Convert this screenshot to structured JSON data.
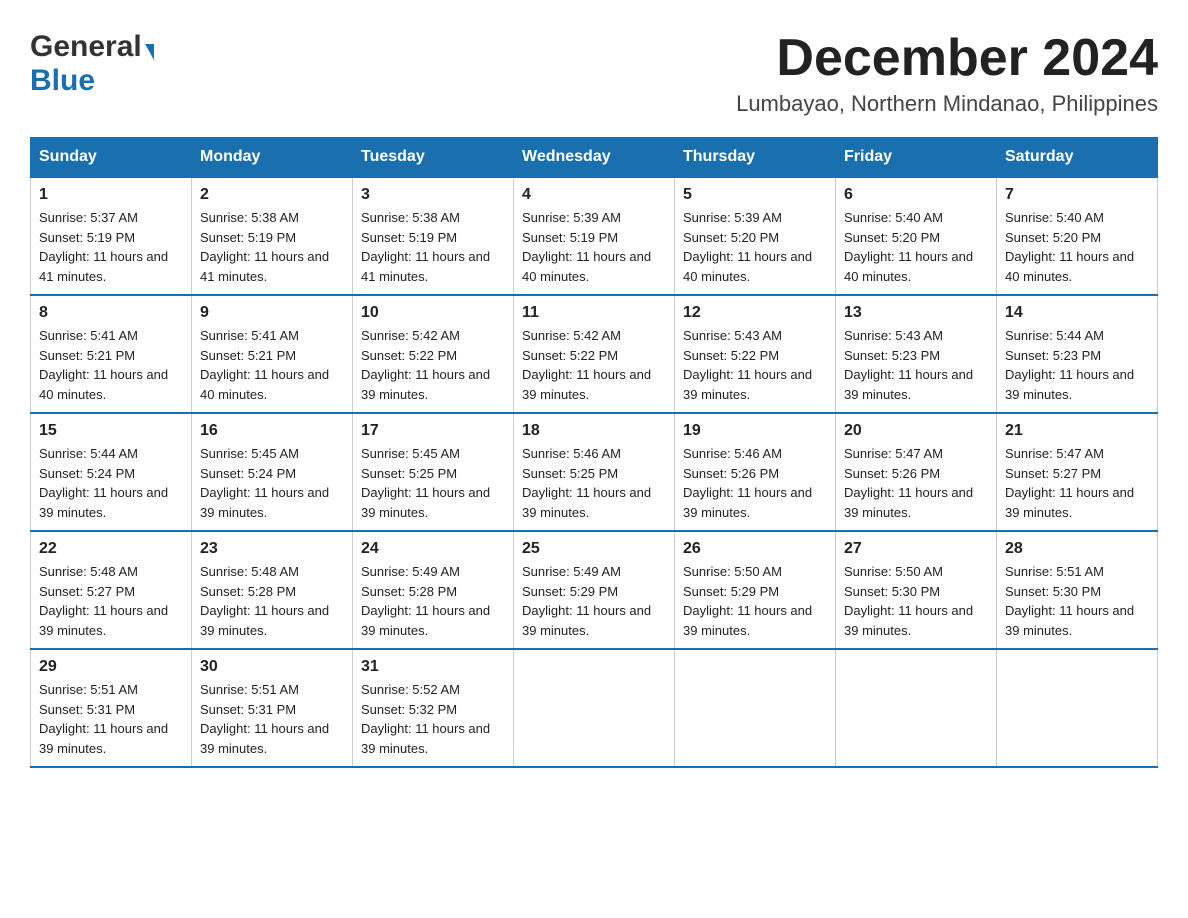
{
  "header": {
    "logo_general": "General",
    "logo_blue": "Blue",
    "month_title": "December 2024",
    "location": "Lumbayao, Northern Mindanao, Philippines"
  },
  "days_of_week": [
    "Sunday",
    "Monday",
    "Tuesday",
    "Wednesday",
    "Thursday",
    "Friday",
    "Saturday"
  ],
  "weeks": [
    [
      {
        "day": "1",
        "sunrise": "5:37 AM",
        "sunset": "5:19 PM",
        "daylight": "11 hours and 41 minutes."
      },
      {
        "day": "2",
        "sunrise": "5:38 AM",
        "sunset": "5:19 PM",
        "daylight": "11 hours and 41 minutes."
      },
      {
        "day": "3",
        "sunrise": "5:38 AM",
        "sunset": "5:19 PM",
        "daylight": "11 hours and 41 minutes."
      },
      {
        "day": "4",
        "sunrise": "5:39 AM",
        "sunset": "5:19 PM",
        "daylight": "11 hours and 40 minutes."
      },
      {
        "day": "5",
        "sunrise": "5:39 AM",
        "sunset": "5:20 PM",
        "daylight": "11 hours and 40 minutes."
      },
      {
        "day": "6",
        "sunrise": "5:40 AM",
        "sunset": "5:20 PM",
        "daylight": "11 hours and 40 minutes."
      },
      {
        "day": "7",
        "sunrise": "5:40 AM",
        "sunset": "5:20 PM",
        "daylight": "11 hours and 40 minutes."
      }
    ],
    [
      {
        "day": "8",
        "sunrise": "5:41 AM",
        "sunset": "5:21 PM",
        "daylight": "11 hours and 40 minutes."
      },
      {
        "day": "9",
        "sunrise": "5:41 AM",
        "sunset": "5:21 PM",
        "daylight": "11 hours and 40 minutes."
      },
      {
        "day": "10",
        "sunrise": "5:42 AM",
        "sunset": "5:22 PM",
        "daylight": "11 hours and 39 minutes."
      },
      {
        "day": "11",
        "sunrise": "5:42 AM",
        "sunset": "5:22 PM",
        "daylight": "11 hours and 39 minutes."
      },
      {
        "day": "12",
        "sunrise": "5:43 AM",
        "sunset": "5:22 PM",
        "daylight": "11 hours and 39 minutes."
      },
      {
        "day": "13",
        "sunrise": "5:43 AM",
        "sunset": "5:23 PM",
        "daylight": "11 hours and 39 minutes."
      },
      {
        "day": "14",
        "sunrise": "5:44 AM",
        "sunset": "5:23 PM",
        "daylight": "11 hours and 39 minutes."
      }
    ],
    [
      {
        "day": "15",
        "sunrise": "5:44 AM",
        "sunset": "5:24 PM",
        "daylight": "11 hours and 39 minutes."
      },
      {
        "day": "16",
        "sunrise": "5:45 AM",
        "sunset": "5:24 PM",
        "daylight": "11 hours and 39 minutes."
      },
      {
        "day": "17",
        "sunrise": "5:45 AM",
        "sunset": "5:25 PM",
        "daylight": "11 hours and 39 minutes."
      },
      {
        "day": "18",
        "sunrise": "5:46 AM",
        "sunset": "5:25 PM",
        "daylight": "11 hours and 39 minutes."
      },
      {
        "day": "19",
        "sunrise": "5:46 AM",
        "sunset": "5:26 PM",
        "daylight": "11 hours and 39 minutes."
      },
      {
        "day": "20",
        "sunrise": "5:47 AM",
        "sunset": "5:26 PM",
        "daylight": "11 hours and 39 minutes."
      },
      {
        "day": "21",
        "sunrise": "5:47 AM",
        "sunset": "5:27 PM",
        "daylight": "11 hours and 39 minutes."
      }
    ],
    [
      {
        "day": "22",
        "sunrise": "5:48 AM",
        "sunset": "5:27 PM",
        "daylight": "11 hours and 39 minutes."
      },
      {
        "day": "23",
        "sunrise": "5:48 AM",
        "sunset": "5:28 PM",
        "daylight": "11 hours and 39 minutes."
      },
      {
        "day": "24",
        "sunrise": "5:49 AM",
        "sunset": "5:28 PM",
        "daylight": "11 hours and 39 minutes."
      },
      {
        "day": "25",
        "sunrise": "5:49 AM",
        "sunset": "5:29 PM",
        "daylight": "11 hours and 39 minutes."
      },
      {
        "day": "26",
        "sunrise": "5:50 AM",
        "sunset": "5:29 PM",
        "daylight": "11 hours and 39 minutes."
      },
      {
        "day": "27",
        "sunrise": "5:50 AM",
        "sunset": "5:30 PM",
        "daylight": "11 hours and 39 minutes."
      },
      {
        "day": "28",
        "sunrise": "5:51 AM",
        "sunset": "5:30 PM",
        "daylight": "11 hours and 39 minutes."
      }
    ],
    [
      {
        "day": "29",
        "sunrise": "5:51 AM",
        "sunset": "5:31 PM",
        "daylight": "11 hours and 39 minutes."
      },
      {
        "day": "30",
        "sunrise": "5:51 AM",
        "sunset": "5:31 PM",
        "daylight": "11 hours and 39 minutes."
      },
      {
        "day": "31",
        "sunrise": "5:52 AM",
        "sunset": "5:32 PM",
        "daylight": "11 hours and 39 minutes."
      },
      null,
      null,
      null,
      null
    ]
  ],
  "labels": {
    "sunrise_prefix": "Sunrise: ",
    "sunset_prefix": "Sunset: ",
    "daylight_prefix": "Daylight: "
  }
}
